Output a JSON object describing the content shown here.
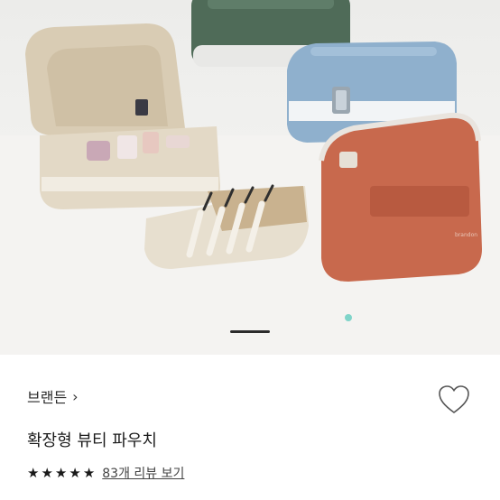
{
  "product": {
    "brand_label": "브랜든",
    "brand_chevron": "›",
    "title": "확장형 뷰티 파우치",
    "rating_stars": 5,
    "star_glyph": "★",
    "review_link": "83개 리뷰 보기"
  },
  "hero": {
    "bag_brand_tag": "brandon",
    "carousel_active_index": 0
  },
  "icons": {
    "wishlist": "heart-outline-icon",
    "brand_arrow": "chevron-right-icon",
    "rating": "star-icon"
  },
  "colors": {
    "green_bag": "#4f6b58",
    "blue_bag": "#8fb0cd",
    "orange_bag": "#c8694d",
    "beige_bag": "#e3d9c6",
    "text": "#1a1a1a"
  }
}
